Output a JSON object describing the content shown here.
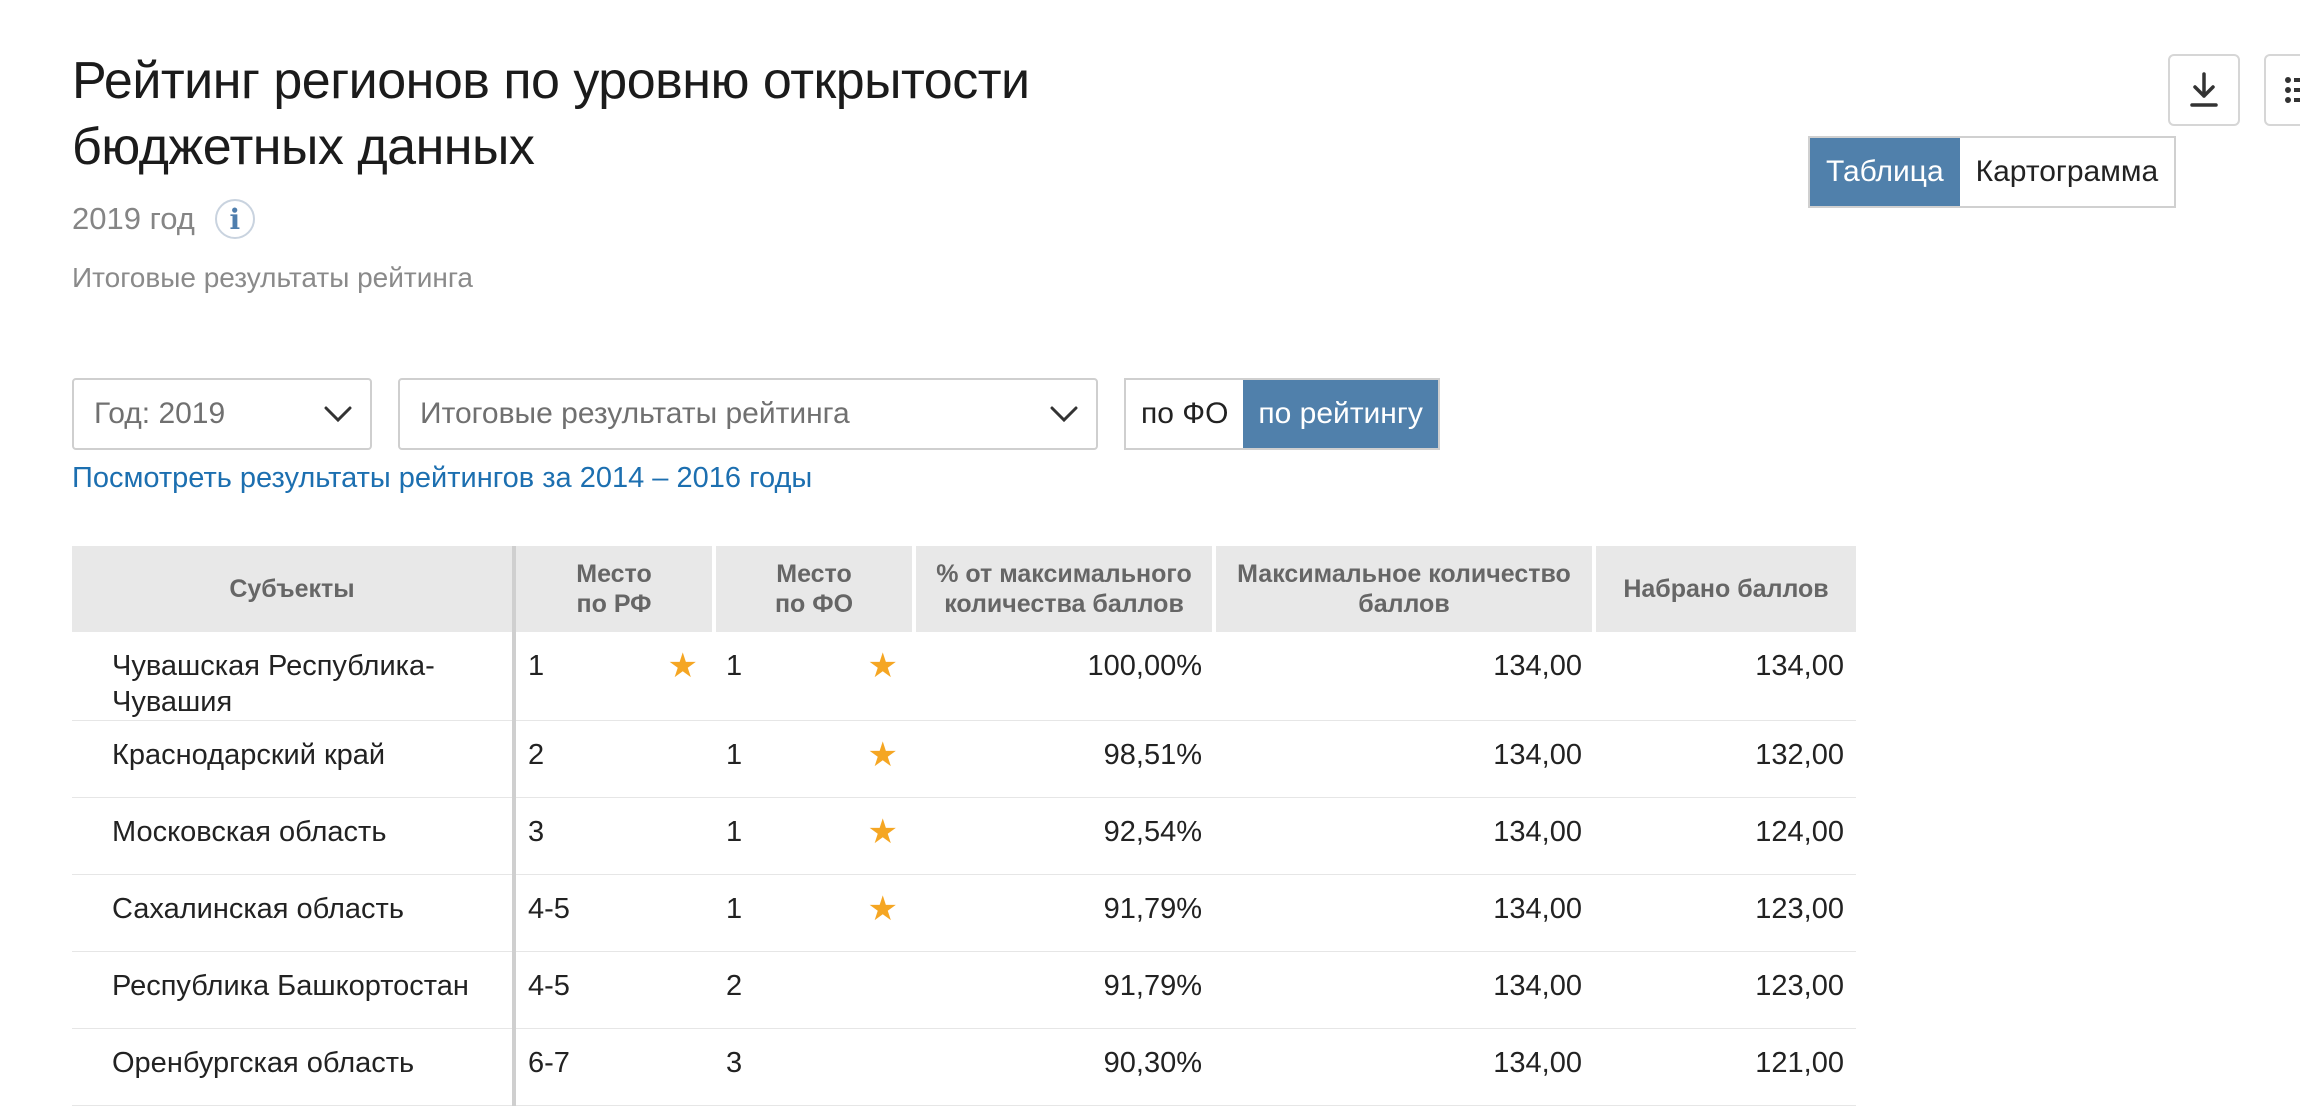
{
  "page": {
    "title": "Рейтинг регионов по уровню открытости бюджетных данных",
    "year_label": "2019 год",
    "info_icon": "info-icon",
    "subtitle": "Итоговые результаты рейтинга"
  },
  "toolbar": {
    "download_icon": "download-icon",
    "list_icon": "list-icon",
    "view_toggle": {
      "table": "Таблица",
      "map": "Картограмма",
      "active": "table"
    }
  },
  "filters": {
    "year_select": "Год: 2019",
    "rating_select": "Итоговые результаты рейтинга",
    "group_toggle": {
      "by_fo": "по ФО",
      "by_rating": "по рейтингу",
      "active": "by_rating"
    },
    "archive_link": "Посмотреть результаты рейтингов за 2014 – 2016 годы"
  },
  "table": {
    "headers": {
      "subject": "Субъекты",
      "place_rf_1": "Место",
      "place_rf_2": "по РФ",
      "place_fo_1": "Место",
      "place_fo_2": "по ФО",
      "percent_1": "% от максимального",
      "percent_2": "количества баллов",
      "max_1": "Максимальное количество",
      "max_2": "баллов",
      "score": "Набрано баллов"
    },
    "rows": [
      {
        "name": "Чувашская Республика-Чувашия",
        "rf": "1",
        "rf_star": true,
        "fo": "1",
        "fo_star": true,
        "percent": "100,00%",
        "max": "134,00",
        "score": "134,00"
      },
      {
        "name": "Краснодарский край",
        "rf": "2",
        "rf_star": false,
        "fo": "1",
        "fo_star": true,
        "percent": "98,51%",
        "max": "134,00",
        "score": "132,00"
      },
      {
        "name": "Московская область",
        "rf": "3",
        "rf_star": false,
        "fo": "1",
        "fo_star": true,
        "percent": "92,54%",
        "max": "134,00",
        "score": "124,00"
      },
      {
        "name": "Сахалинская область",
        "rf": "4-5",
        "rf_star": false,
        "fo": "1",
        "fo_star": true,
        "percent": "91,79%",
        "max": "134,00",
        "score": "123,00"
      },
      {
        "name": "Республика Башкортостан",
        "rf": "4-5",
        "rf_star": false,
        "fo": "2",
        "fo_star": false,
        "percent": "91,79%",
        "max": "134,00",
        "score": "123,00"
      },
      {
        "name": "Оренбургская область",
        "rf": "6-7",
        "rf_star": false,
        "fo": "3",
        "fo_star": false,
        "percent": "90,30%",
        "max": "134,00",
        "score": "121,00"
      }
    ]
  },
  "colors": {
    "accent": "#5080ab",
    "link": "#1c6fb0",
    "star": "#f5a623",
    "header_bg": "#e8e8e8"
  }
}
